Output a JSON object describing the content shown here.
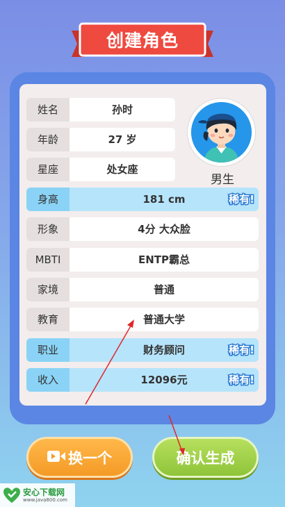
{
  "header": {
    "title": "创建角色"
  },
  "profile": {
    "name": {
      "label": "姓名",
      "value": "孙时"
    },
    "age": {
      "label": "年龄",
      "value": "27 岁"
    },
    "zodiac": {
      "label": "星座",
      "value": "处女座"
    },
    "gender": "男生",
    "avatar_icon": "boy-avatar-icon"
  },
  "attributes": [
    {
      "label": "身高",
      "value": "181 cm",
      "rare": true,
      "rare_label": "稀有!"
    },
    {
      "label": "形象",
      "value": "4分 大众脸",
      "rare": false
    },
    {
      "label": "MBTI",
      "value": "ENTP霸总",
      "rare": false
    },
    {
      "label": "家境",
      "value": "普通",
      "rare": false
    },
    {
      "label": "教育",
      "value": "普通大学",
      "rare": false
    },
    {
      "label": "职业",
      "value": "财务顾问",
      "rare": true,
      "rare_label": "稀有!"
    },
    {
      "label": "收入",
      "value": "12096元",
      "rare": true,
      "rare_label": "稀有!"
    }
  ],
  "buttons": {
    "swap": {
      "label": "换一个",
      "icon": "video-camera-icon"
    },
    "confirm": {
      "label": "确认生成"
    }
  },
  "watermark": {
    "name": "安心下载网",
    "url": "www.java800.com"
  },
  "colors": {
    "frame": "#5b86e3",
    "rare_highlight": "#b6e4fb",
    "swap_button": "#f49a26",
    "confirm_button": "#8fc43a",
    "ribbon": "#ee4a40",
    "annotation_arrow": "#e0262b"
  }
}
